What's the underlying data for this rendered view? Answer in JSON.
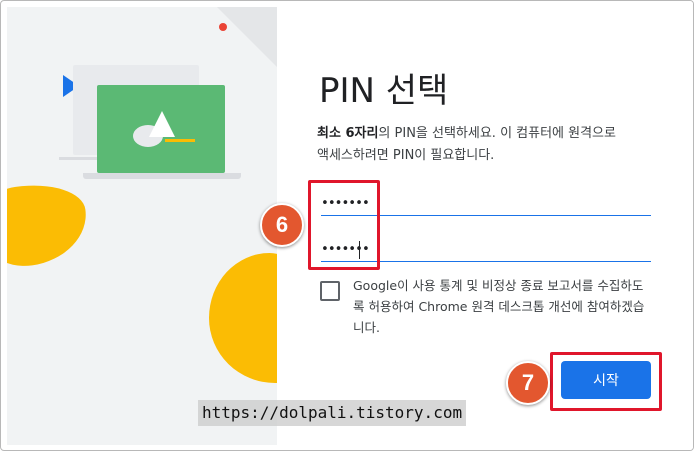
{
  "dialog": {
    "title": "PIN 선택",
    "description_bold": "최소 6자리",
    "description_rest": "의 PIN을 선택하세요. 이 컴퓨터에 원격으로 액세스하려면 PIN이 필요합니다.",
    "pin_value": "•••••••",
    "pin_confirm_value": "•••••••",
    "checkbox_label": "Google이 사용 통계 및 비정상 종료 보고서를 수집하도록 허용하여 Chrome 원격 데스크톱 개선에 참여하겠습니다.",
    "start_label": "시작"
  },
  "annotations": {
    "step6": "6",
    "step7": "7",
    "watermark": "https://dolpali.tistory.com"
  },
  "colors": {
    "accent": "#1a73e8",
    "highlight": "#e0162b",
    "badge": "#e3572f",
    "illustration_green": "#5bb974",
    "illustration_yellow": "#fbbc04"
  }
}
